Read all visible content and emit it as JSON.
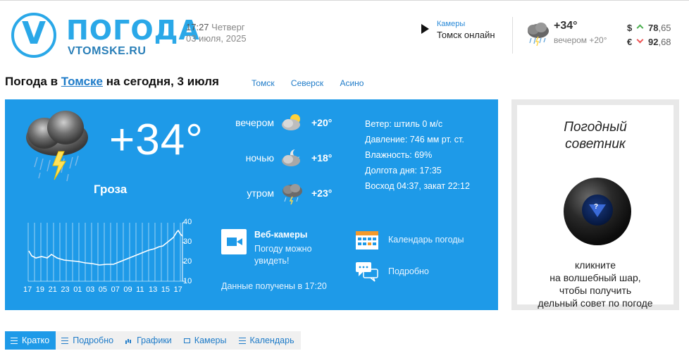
{
  "header": {
    "logo_letter": "V",
    "logo_name": "ПОГОДА",
    "logo_site": "VTOMSKE.RU",
    "time": "17:27",
    "weekday": "Четверг",
    "date": "03 июля, 2025",
    "cam_small": "Камеры",
    "cam_title": "Томск онлайн",
    "mini_temp": "+34°",
    "mini_evening": "вечером +20°",
    "usd_symbol": "$",
    "usd_int": "78",
    "usd_frac": ",65",
    "eur_symbol": "€",
    "eur_int": "92",
    "eur_frac": ",68"
  },
  "title": {
    "prefix": "Погода в ",
    "city": "Томске",
    "suffix": " на сегодня, 3 июля",
    "cities": [
      "Томск",
      "Северск",
      "Асино"
    ]
  },
  "current": {
    "temp": "+34°",
    "condition": "Гроза",
    "forecast": [
      {
        "label": "вечером",
        "temp": "+20°",
        "icon": "cloud-sun-icon"
      },
      {
        "label": "ночью",
        "temp": "+18°",
        "icon": "cloud-moon-icon"
      },
      {
        "label": "утром",
        "temp": "+23°",
        "icon": "storm-icon"
      }
    ],
    "details": [
      "Ветер: штиль 0 м/с",
      "Давление: 746 мм рт. ст.",
      "Влажность: 69%",
      "Долгота дня: 17:35",
      "Восход 04:37, закат 22:12"
    ],
    "graph_hours": [
      "17",
      "19",
      "21",
      "23",
      "01",
      "03",
      "05",
      "07",
      "09",
      "11",
      "13",
      "15",
      "17"
    ],
    "graph_y": [
      "40",
      "30",
      "20",
      "10"
    ],
    "webcam_title": "Веб-камеры",
    "webcam_sub1": "Погоду можно",
    "webcam_sub2": "увидеть!",
    "received": "Данные получены в 17:20",
    "calendar_link": "Календарь погоды",
    "detail_link": "Подробно"
  },
  "advisor": {
    "title1": "Погодный",
    "title2": "советник",
    "q": "?",
    "text1": "кликните",
    "text2": "на волшебный шар,",
    "text3": "чтобы получить",
    "text4": "дельный совет по погоде"
  },
  "tabs": [
    {
      "label": "Кратко",
      "active": true
    },
    {
      "label": "Подробно",
      "active": false
    },
    {
      "label": "Графики",
      "active": false
    },
    {
      "label": "Камеры",
      "active": false
    },
    {
      "label": "Календарь",
      "active": false
    }
  ],
  "colors": {
    "accent": "#1e9ae8",
    "link": "#1e7bc8",
    "logo": "#2aa8e8"
  }
}
